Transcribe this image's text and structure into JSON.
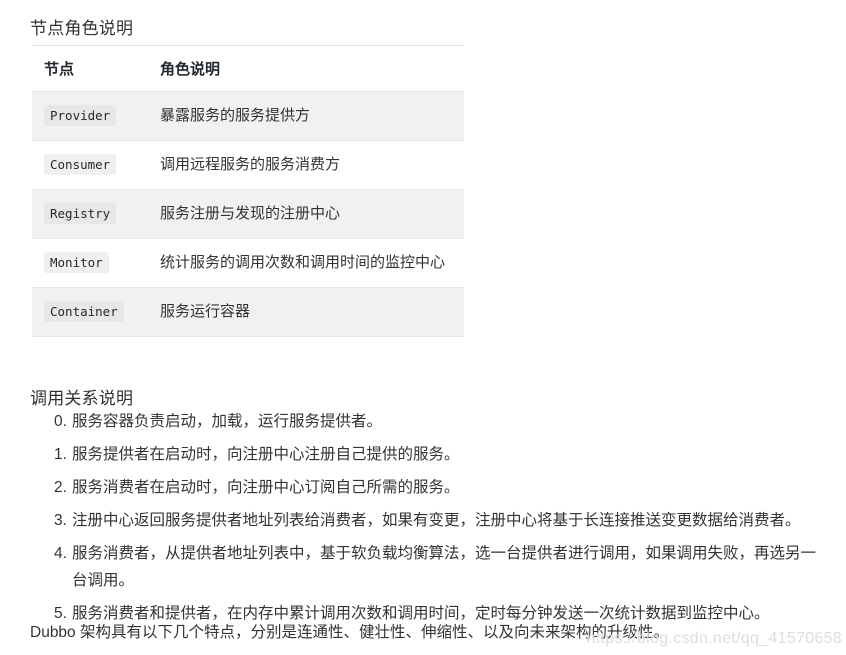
{
  "headings": {
    "roles": "节点角色说明",
    "relations": "调用关系说明"
  },
  "role_table": {
    "columns": [
      "节点",
      "角色说明"
    ],
    "rows": [
      {
        "node": "Provider",
        "desc": "暴露服务的服务提供方"
      },
      {
        "node": "Consumer",
        "desc": "调用远程服务的服务消费方"
      },
      {
        "node": "Registry",
        "desc": "服务注册与发现的注册中心"
      },
      {
        "node": "Monitor",
        "desc": "统计服务的调用次数和调用时间的监控中心"
      },
      {
        "node": "Container",
        "desc": "服务运行容器"
      }
    ]
  },
  "relation_list": {
    "items": [
      {
        "marker": "0.",
        "text": "服务容器负责启动，加载，运行服务提供者。"
      },
      {
        "marker": "1.",
        "text": "服务提供者在启动时，向注册中心注册自己提供的服务。"
      },
      {
        "marker": "2.",
        "text": "服务消费者在启动时，向注册中心订阅自己所需的服务。"
      },
      {
        "marker": "3.",
        "text": "注册中心返回服务提供者地址列表给消费者，如果有变更，注册中心将基于长连接推送变更数据给消费者。"
      },
      {
        "marker": "4.",
        "text": "服务消费者，从提供者地址列表中，基于软负载均衡算法，选一台提供者进行调用，如果调用失败，再选另一台调用。"
      },
      {
        "marker": "5.",
        "text": "服务消费者和提供者，在内存中累计调用次数和调用时间，定时每分钟发送一次统计数据到监控中心。"
      }
    ]
  },
  "closing_paragraph": "Dubbo 架构具有以下几个特点，分别是连通性、健壮性、伸缩性、以及向未来架构的升级性。",
  "watermark": "https://blog.csdn.net/qq_41570658",
  "colors": {
    "page_background": "#ffffff",
    "text": "#333333",
    "heading": "#303133",
    "table_stripe": "#f1f1f1",
    "table_border": "#e9e9e9",
    "chip_background": "#efefef",
    "watermark": "#dddddd"
  }
}
